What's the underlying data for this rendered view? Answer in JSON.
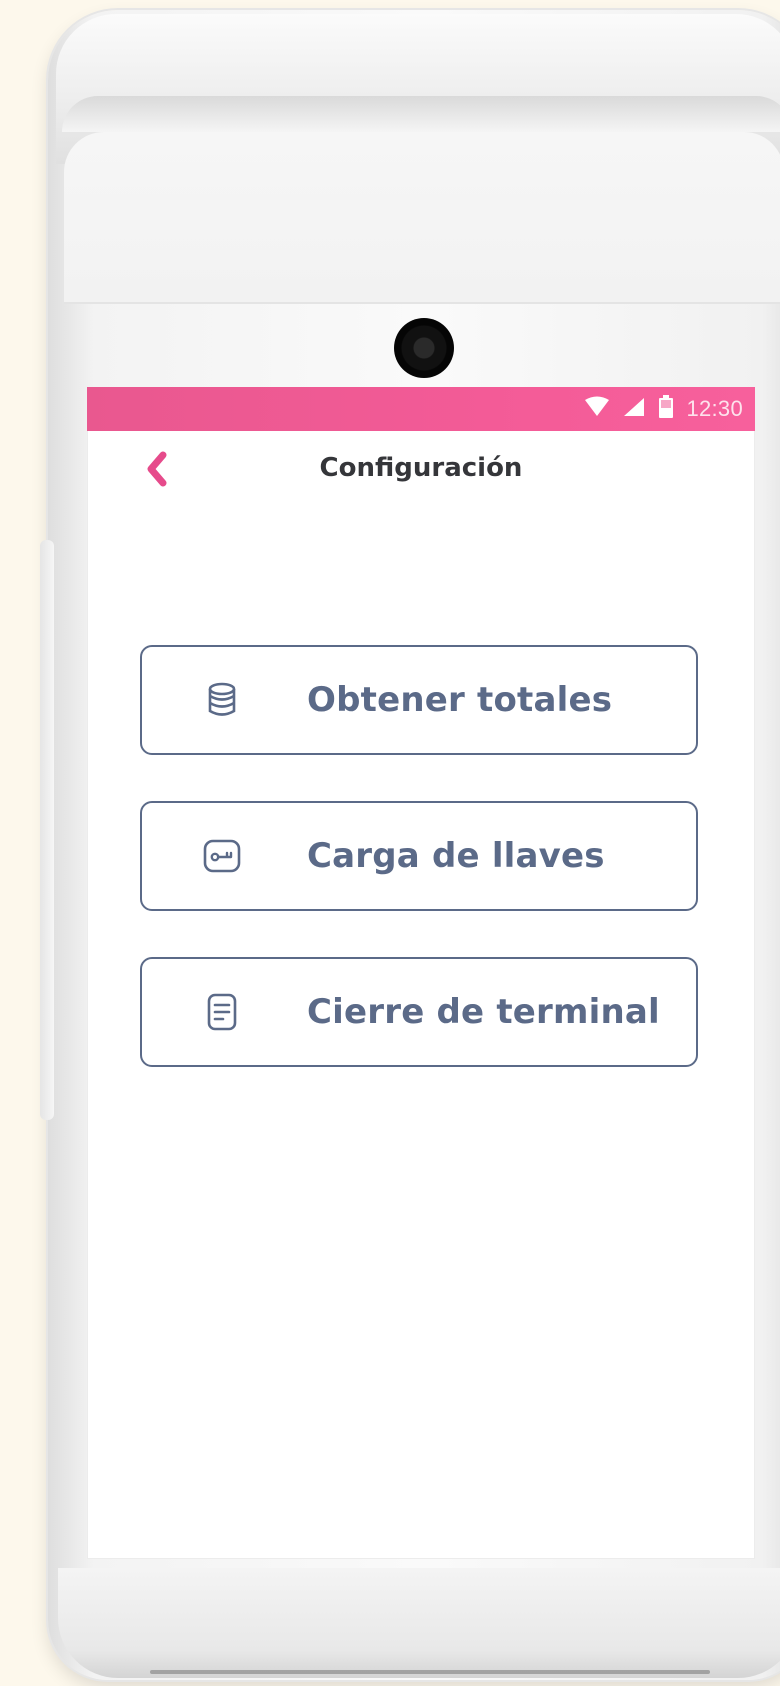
{
  "status_bar": {
    "time": "12:30",
    "icons": [
      "wifi-icon",
      "signal-icon",
      "battery-icon"
    ],
    "color": "#f35b97"
  },
  "header": {
    "title": "Configuración",
    "back_icon": "chevron-left-icon",
    "accent": "#e64b8b"
  },
  "menu": {
    "items": [
      {
        "label": "Obtener totales",
        "icon": "database-icon"
      },
      {
        "label": "Carga de llaves",
        "icon": "key-icon"
      },
      {
        "label": "Cierre de terminal",
        "icon": "document-icon"
      }
    ],
    "color": "#5b6a88"
  }
}
